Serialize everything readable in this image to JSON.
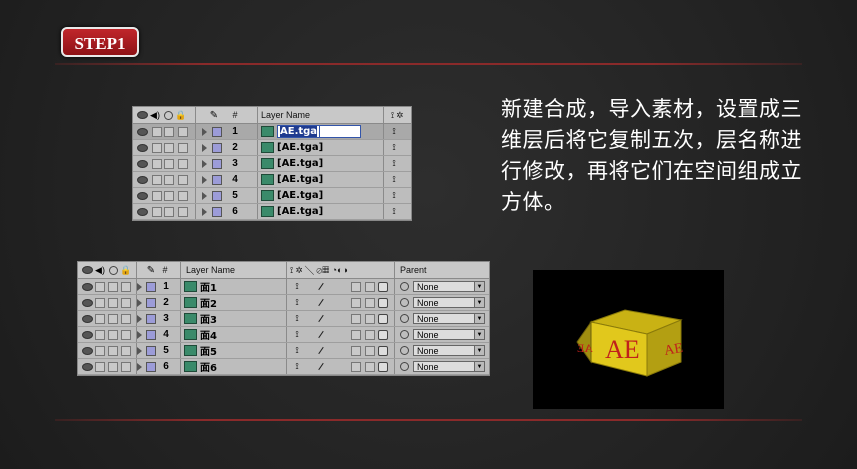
{
  "step_label": "STEP1",
  "description": "新建合成，导入素材，设置成三维层后将它复制五次，层名称进行修改，再将它们在空间组成立方体。",
  "panel1": {
    "header": {
      "hash": "#",
      "layer_name": "Layer Name"
    },
    "rows": [
      {
        "num": "1",
        "name": "AE.tga",
        "editing": true
      },
      {
        "num": "2",
        "name": "[AE.tga]"
      },
      {
        "num": "3",
        "name": "[AE.tga]"
      },
      {
        "num": "4",
        "name": "[AE.tga]"
      },
      {
        "num": "5",
        "name": "[AE.tga]"
      },
      {
        "num": "6",
        "name": "[AE.tga]"
      }
    ]
  },
  "panel2": {
    "header": {
      "hash": "#",
      "layer_name": "Layer Name",
      "parent": "Parent"
    },
    "rows": [
      {
        "num": "1",
        "name": "面1",
        "parent": "None"
      },
      {
        "num": "2",
        "name": "面2",
        "parent": "None"
      },
      {
        "num": "3",
        "name": "面3",
        "parent": "None"
      },
      {
        "num": "4",
        "name": "面4",
        "parent": "None"
      },
      {
        "num": "5",
        "name": "面5",
        "parent": "None"
      },
      {
        "num": "6",
        "name": "面6",
        "parent": "None"
      }
    ]
  },
  "preview": {
    "cube_text": "AE",
    "cube_color": "#d9c21a",
    "text_color": "#c0201b"
  },
  "colors": {
    "accent": "#b01e22",
    "panel_bg": "#b9b9b9"
  }
}
